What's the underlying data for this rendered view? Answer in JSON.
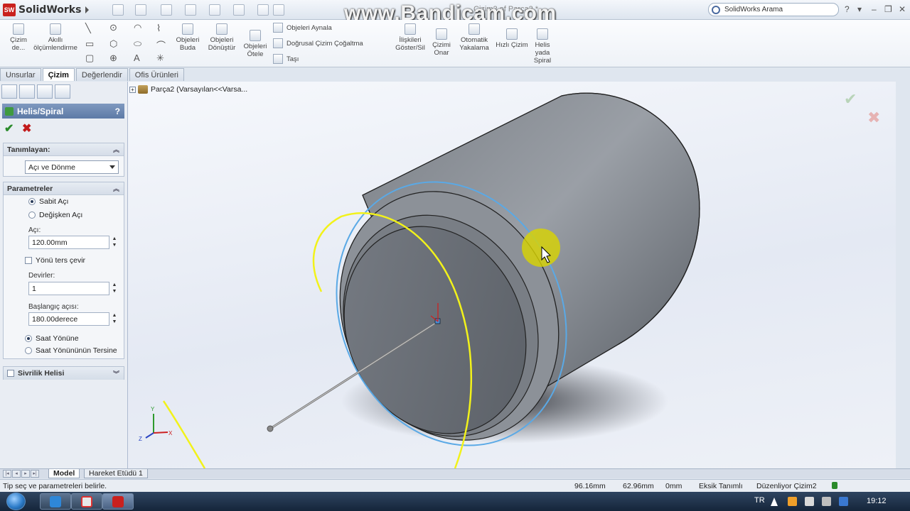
{
  "app": {
    "name": "SolidWorks",
    "logo_mark": "SW",
    "doc_title": "Çizim2 of Parça2 *",
    "watermark": "www.Bandicam.com",
    "search_placeholder": "SolidWorks Arama",
    "win_controls": [
      "?",
      "▾",
      "–",
      "❐",
      "✕"
    ]
  },
  "toolbar": {
    "smart_dim_1": "Çizim",
    "smart_dim_2": "de...",
    "akilli_1": "Akıllı",
    "akilli_2": "ölçümlendirme",
    "trim_1": "Objeleri",
    "trim_2": "Buda",
    "convert_1": "Objeleri",
    "convert_2": "Dönüştür",
    "offset_1": "Objeleri",
    "offset_2": "Ötele",
    "mirror": "Objeleri Aynala",
    "linear_pattern": "Doğrusal Çizim Çoğaltma",
    "move": "Taşı",
    "relations_1": "İlişkileri",
    "relations_2": "Göster/Sil",
    "repair_1": "Çizimi",
    "repair_2": "Onar",
    "snap_1": "Otomatik",
    "snap_2": "Yakalama",
    "rapid_sketch": "Hızlı Çizim",
    "helix_1": "Helis",
    "helix_2": "yada",
    "helix_3": "Spiral"
  },
  "tabs": [
    "Unsurlar",
    "Çizim",
    "Değerlendir",
    "Ofis Ürünleri"
  ],
  "panel": {
    "title": "Helis/Spiral",
    "help": "?",
    "ok": "✔",
    "cancel": "✖",
    "defined_by": {
      "header": "Tanımlayan:",
      "value": "Açı ve Dönme"
    },
    "parameters": {
      "header": "Parametreler",
      "constant_pitch": "Sabit Açı",
      "variable_pitch": "Değişken Açı",
      "pitch_label": "Açı:",
      "pitch_value": "120.00mm",
      "reverse_direction": "Yönü ters çevir",
      "revolutions_label": "Devirler:",
      "revolutions_value": "1",
      "start_angle_label": "Başlangıç açısı:",
      "start_angle_value": "180.00derece",
      "clockwise": "Saat Yönüne",
      "counterclockwise": "Saat Yönününün Tersine"
    },
    "taper": {
      "header": "Sivrilik Helisi"
    }
  },
  "graphics": {
    "tree_label": "Parça2  (Varsayılan<<Varsa...",
    "triad_x": "X",
    "triad_y": "Y",
    "triad_z": "Z"
  },
  "bottom_tabs": [
    "Model",
    "Hareket Etüdü 1"
  ],
  "status": {
    "hint": "Tip seç ve parametreleri belirle.",
    "x": "96.16mm",
    "y": "62.96mm",
    "z": "0mm",
    "defined_state": "Eksik Tanımlı",
    "editing": "Düzenliyor Çizim2"
  },
  "taskbar": {
    "lang": "TR",
    "time": "19:12"
  },
  "colors": {
    "helix_yellow": "#f2f21a",
    "helix_blue": "#5aa9e6",
    "cursor_highlight": "#d9d400",
    "part_gray": "#6e737a"
  }
}
